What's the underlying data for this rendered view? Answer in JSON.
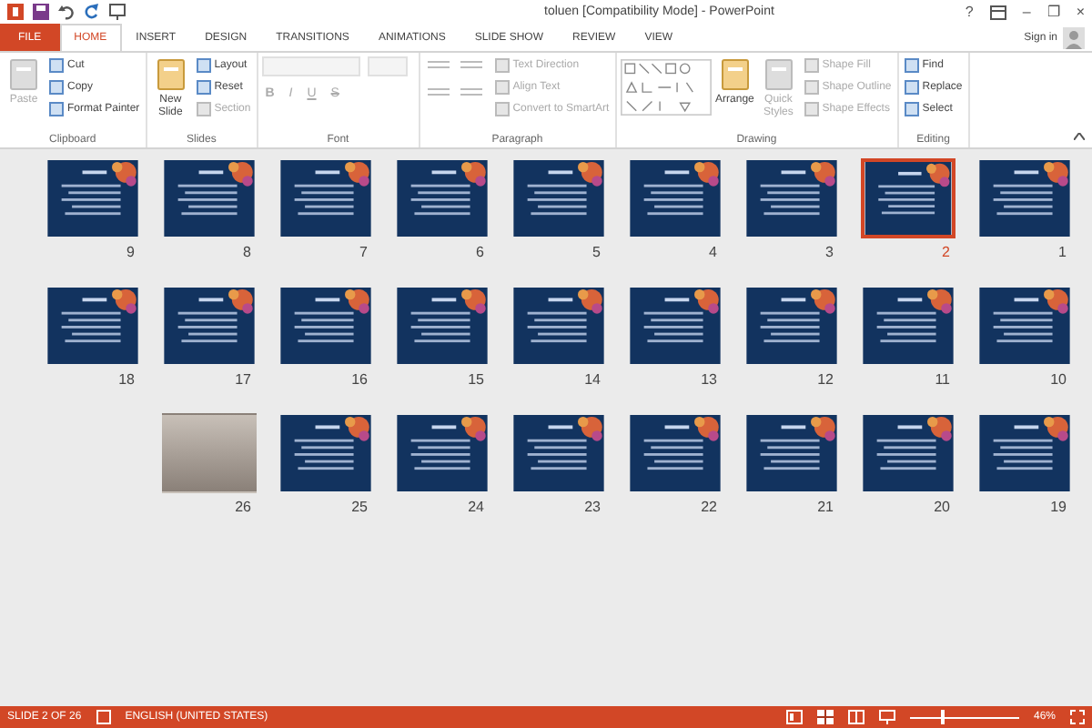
{
  "title_bar": {
    "title": "toluen [Compatibility Mode] - PowerPoint",
    "help": "?",
    "minimize": "–",
    "maximize": "❐",
    "close": "×"
  },
  "tabs": [
    {
      "label": "FILE",
      "kind": "file",
      "selected": false
    },
    {
      "label": "HOME",
      "kind": "tab",
      "selected": true
    },
    {
      "label": "INSERT",
      "kind": "tab",
      "selected": false
    },
    {
      "label": "DESIGN",
      "kind": "tab",
      "selected": false
    },
    {
      "label": "TRANSITIONS",
      "kind": "tab",
      "selected": false
    },
    {
      "label": "ANIMATIONS",
      "kind": "tab",
      "selected": false
    },
    {
      "label": "SLIDE SHOW",
      "kind": "tab",
      "selected": false
    },
    {
      "label": "REVIEW",
      "kind": "tab",
      "selected": false
    },
    {
      "label": "VIEW",
      "kind": "tab",
      "selected": false
    }
  ],
  "account": {
    "label": "Sign in"
  },
  "ribbon_groups": [
    {
      "name": "Clipboard",
      "items": [
        {
          "kind": "large",
          "label": "Paste",
          "disabled": true
        },
        {
          "kind": "small",
          "label": "Cut",
          "disabled": false
        },
        {
          "kind": "small",
          "label": "Copy",
          "disabled": false
        },
        {
          "kind": "small",
          "label": "Format Painter",
          "disabled": false
        }
      ]
    },
    {
      "name": "Slides",
      "items": [
        {
          "kind": "large",
          "label": "New Slide",
          "disabled": false
        },
        {
          "kind": "small",
          "label": "Layout",
          "disabled": false
        },
        {
          "kind": "small",
          "label": "Reset",
          "disabled": false
        },
        {
          "kind": "small",
          "label": "Section",
          "disabled": true
        }
      ]
    },
    {
      "name": "Font",
      "items": [
        {
          "kind": "fields",
          "disabled": true
        }
      ]
    },
    {
      "name": "Paragraph",
      "items": [
        {
          "kind": "bullets",
          "disabled": true
        },
        {
          "kind": "small",
          "label": "Text Direction",
          "disabled": true
        },
        {
          "kind": "small",
          "label": "Align Text",
          "disabled": true
        },
        {
          "kind": "small",
          "label": "Convert to SmartArt",
          "disabled": true
        }
      ]
    },
    {
      "name": "Drawing",
      "items": [
        {
          "kind": "gallery",
          "disabled": false
        },
        {
          "kind": "large",
          "label": "Arrange",
          "disabled": false
        },
        {
          "kind": "large",
          "label": "Quick Styles",
          "disabled": true
        },
        {
          "kind": "small",
          "label": "Shape Fill",
          "disabled": true
        },
        {
          "kind": "small",
          "label": "Shape Outline",
          "disabled": true
        },
        {
          "kind": "small",
          "label": "Shape Effects",
          "disabled": true
        }
      ]
    },
    {
      "name": "Editing",
      "items": [
        {
          "kind": "small",
          "label": "Find",
          "disabled": false
        },
        {
          "kind": "small",
          "label": "Replace",
          "disabled": false
        },
        {
          "kind": "small",
          "label": "Select",
          "disabled": false
        }
      ]
    }
  ],
  "font_buttons": [
    "B",
    "I",
    "U",
    "S"
  ],
  "slides": [
    {
      "number": "9",
      "kind": "slide",
      "selected": false
    },
    {
      "number": "8",
      "kind": "slide",
      "selected": false
    },
    {
      "number": "7",
      "kind": "slide",
      "selected": false
    },
    {
      "number": "6",
      "kind": "slide",
      "selected": false
    },
    {
      "number": "5",
      "kind": "slide",
      "selected": false
    },
    {
      "number": "4",
      "kind": "slide",
      "selected": false
    },
    {
      "number": "3",
      "kind": "slide",
      "selected": false
    },
    {
      "number": "2",
      "kind": "slide",
      "selected": true
    },
    {
      "number": "1",
      "kind": "slide",
      "selected": false
    },
    {
      "number": "18",
      "kind": "slide",
      "selected": false
    },
    {
      "number": "17",
      "kind": "slide",
      "selected": false
    },
    {
      "number": "16",
      "kind": "slide",
      "selected": false
    },
    {
      "number": "15",
      "kind": "slide",
      "selected": false
    },
    {
      "number": "14",
      "kind": "slide",
      "selected": false
    },
    {
      "number": "13",
      "kind": "slide",
      "selected": false
    },
    {
      "number": "12",
      "kind": "slide",
      "selected": false
    },
    {
      "number": "11",
      "kind": "slide",
      "selected": false
    },
    {
      "number": "10",
      "kind": "slide",
      "selected": false
    },
    {
      "number": "26",
      "kind": "photo",
      "selected": false
    },
    {
      "number": "25",
      "kind": "slide",
      "selected": false
    },
    {
      "number": "24",
      "kind": "slide",
      "selected": false
    },
    {
      "number": "23",
      "kind": "slide",
      "selected": false
    },
    {
      "number": "22",
      "kind": "slide",
      "selected": false
    },
    {
      "number": "21",
      "kind": "slide",
      "selected": false
    },
    {
      "number": "20",
      "kind": "slide",
      "selected": false
    },
    {
      "number": "19",
      "kind": "slide",
      "selected": false
    }
  ],
  "status_bar": {
    "slide_position": "SLIDE 2 OF 26",
    "language": "ENGLISH (UNITED STATES)",
    "zoom": {
      "level": 0.3,
      "reading": "46%"
    }
  }
}
